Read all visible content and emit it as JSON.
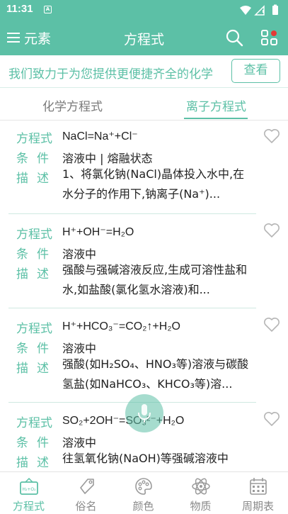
{
  "status_bar": {
    "time": "11:31",
    "notification_badge": "A"
  },
  "app_bar": {
    "menu_label": "元素",
    "title": "方程式"
  },
  "banner": {
    "text": "我们致力于为您提供更便捷齐全的化学",
    "button": "查看"
  },
  "tabs": [
    {
      "label": "化学方程式",
      "active": false
    },
    {
      "label": "离子方程式",
      "active": true
    }
  ],
  "labels": {
    "equation": "方程式",
    "condition": "条件",
    "description": "描述"
  },
  "entries": [
    {
      "equation": "NaCl=Na⁺+Cl⁻",
      "condition": "溶液中 | 熔融状态",
      "description": "1、将氯化钠(NaCl)晶体投入水中,在水分子的作用下,钠离子(Na⁺)..."
    },
    {
      "equation": "H⁺+OH⁻=H₂O",
      "condition": "溶液中",
      "description": "强酸与强碱溶液反应,生成可溶性盐和水,如盐酸(氯化氢水溶液)和..."
    },
    {
      "equation": "H⁺+HCO₃⁻=CO₂↑+H₂O",
      "condition": "溶液中",
      "description": "强酸(如H₂SO₄、HNO₃等)溶液与碳酸氢盐(如NaHCO₃、KHCO₃等)溶..."
    },
    {
      "equation": "SO₂+2OH⁻=SO₃²⁻+H₂O",
      "condition": "溶液中",
      "description": "往氢氧化钠(NaOH)等强碱溶液中"
    }
  ],
  "bottom_nav": [
    {
      "label": "方程式",
      "icon": "formula-board-icon",
      "active": true
    },
    {
      "label": "俗名",
      "icon": "tag-icon",
      "active": false
    },
    {
      "label": "颜色",
      "icon": "palette-icon",
      "active": false
    },
    {
      "label": "物质",
      "icon": "atom-icon",
      "active": false
    },
    {
      "label": "周期表",
      "icon": "calendar-grid-icon",
      "active": false
    }
  ],
  "colors": {
    "accent": "#5cc0a6",
    "text": "#222222",
    "muted": "#8a8a8a",
    "notification_dot": "#e53935"
  }
}
